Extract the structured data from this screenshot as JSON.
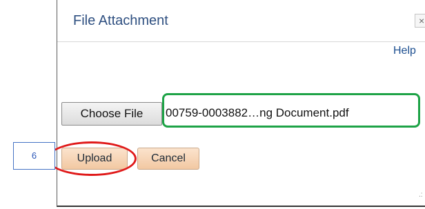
{
  "dialog": {
    "title": "File Attachment",
    "close_glyph": "×",
    "help_link": "Help",
    "choose_file_button": "Choose File",
    "selected_file": "00759-0003882…ng Document.pdf",
    "upload_button": "Upload",
    "cancel_button": "Cancel",
    "resize_grip_glyph": ".:"
  },
  "annotations": {
    "step_number": "6",
    "highlight_colors": {
      "file_name_box": "#1ea347",
      "upload_oval": "#e01a1a",
      "callout_border": "#4472c4"
    }
  },
  "icons": [
    "close-icon",
    "resize-grip-icon"
  ]
}
